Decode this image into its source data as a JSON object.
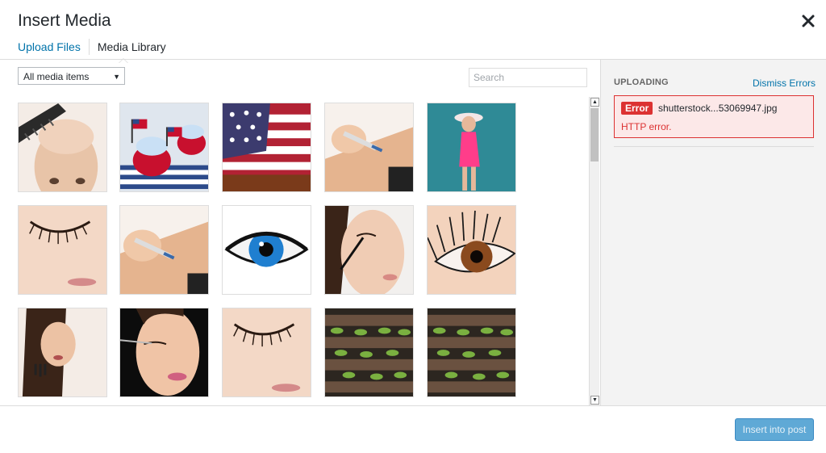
{
  "modal": {
    "title": "Insert Media",
    "close_icon": "close-icon"
  },
  "tabs": [
    {
      "label": "Upload Files"
    },
    {
      "label": "Media Library"
    }
  ],
  "toolbar": {
    "filter_selected": "All media items",
    "search_placeholder": "Search"
  },
  "sidebar": {
    "section_label": "UPLOADING",
    "dismiss_label": "Dismiss Errors",
    "error": {
      "badge": "Error",
      "filename": "shutterstock...53069947.jpg",
      "message": "HTTP error."
    }
  },
  "footer": {
    "insert_label": "Insert into post"
  },
  "colors": {
    "link": "#0073aa",
    "error": "#dc3232",
    "primary_button": "#5fa9d6"
  },
  "media_items": [
    {
      "subject": "balding man with comb"
    },
    {
      "subject": "patriotic cupcakes with flags"
    },
    {
      "subject": "american flag"
    },
    {
      "subject": "injection in arm"
    },
    {
      "subject": "woman in pink dress with hat"
    },
    {
      "subject": "closed eye with long lashes"
    },
    {
      "subject": "injection in arm"
    },
    {
      "subject": "blue eye close-up"
    },
    {
      "subject": "woman applying mascara"
    },
    {
      "subject": "brown eye with lashes"
    },
    {
      "subject": "woman with long nails"
    },
    {
      "subject": "woman applying eye makeup"
    },
    {
      "subject": "closed eye with long lashes"
    },
    {
      "subject": "food tray"
    },
    {
      "subject": "food tray"
    }
  ]
}
